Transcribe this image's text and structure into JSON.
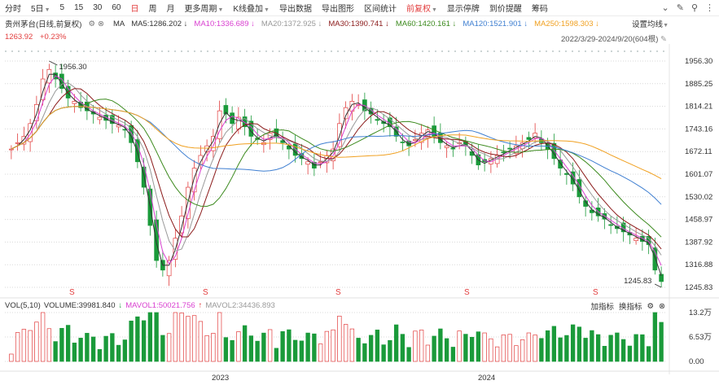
{
  "toolbar": {
    "items": [
      {
        "label": "分时",
        "active": false
      },
      {
        "label": "5日",
        "active": false,
        "dropdown": true
      },
      {
        "label": "5",
        "active": false
      },
      {
        "label": "15",
        "active": false
      },
      {
        "label": "30",
        "active": false
      },
      {
        "label": "60",
        "active": false
      },
      {
        "label": "日",
        "active": true
      },
      {
        "label": "周",
        "active": false
      },
      {
        "label": "月",
        "active": false
      },
      {
        "label": "更多周期",
        "active": false,
        "dropdown": true
      },
      {
        "label": "K线叠加",
        "active": false,
        "dropdown": true
      },
      {
        "label": "导出数据",
        "active": false
      },
      {
        "label": "导出图形",
        "active": false
      },
      {
        "label": "区间统计",
        "active": false
      },
      {
        "label": "前复权",
        "active": true,
        "dropdown": true
      },
      {
        "label": "显示停牌",
        "active": false
      },
      {
        "label": "到价提醒",
        "active": false
      },
      {
        "label": "筹码",
        "active": false
      }
    ]
  },
  "stock": {
    "title": "贵州茅台(日线,前复权)",
    "ma_label": "MA",
    "price": "1263.92",
    "change": "+0.23%"
  },
  "ma": [
    {
      "text": "MA5:1286.202",
      "arrow": "↓",
      "color": "#333333"
    },
    {
      "text": "MA10:1336.689",
      "arrow": "↓",
      "color": "#d93fd0"
    },
    {
      "text": "MA20:1372.925",
      "arrow": "↓",
      "color": "#999999"
    },
    {
      "text": "MA30:1390.741",
      "arrow": "↓",
      "color": "#8b1a1a"
    },
    {
      "text": "MA60:1420.161",
      "arrow": "↓",
      "color": "#3c8a1e"
    },
    {
      "text": "MA120:1521.901",
      "arrow": "↓",
      "color": "#3f7fd1"
    },
    {
      "text": "MA250:1598.303",
      "arrow": "↓",
      "color": "#f0a020"
    }
  ],
  "settings_label": "设置均线",
  "date_range": "2022/3/29-2024/9/20(604根)",
  "price_axis": [
    "1956.30",
    "1885.25",
    "1814.21",
    "1743.16",
    "1672.11",
    "1601.07",
    "1530.02",
    "1458.97",
    "1387.92",
    "1316.88",
    "1245.83"
  ],
  "annotations": {
    "high": "1956.30",
    "low": "1245.83"
  },
  "volume": {
    "label": "VOL(5,10)",
    "volume_text": "VOLUME:39981.840",
    "mavol1": "MAVOL1:50021.756",
    "mavol2": "MAVOL2:34436.893",
    "mavol1_arrow": "↓",
    "mavol2_arrow": "↑",
    "axis": [
      "13.2万",
      "6.53万",
      "0.00"
    ],
    "tools": {
      "add": "加指标",
      "switch": "换指标"
    }
  },
  "x_axis": [
    "2023",
    "2024"
  ],
  "colors": {
    "up": "#e23d3d",
    "down": "#1a9a3a",
    "ma5": "#333333",
    "ma10": "#d93fd0",
    "ma20": "#999999",
    "ma30": "#8b1a1a",
    "ma60": "#3c8a1e",
    "ma120": "#3f7fd1",
    "ma250": "#f0a020"
  },
  "chart_data": {
    "type": "candlestick",
    "series_note": "daily closes",
    "close": [
      1680,
      1700,
      1720,
      1760,
      1820,
      1900,
      1930,
      1900,
      1870,
      1840,
      1830,
      1810,
      1800,
      1790,
      1780,
      1770,
      1760,
      1755,
      1740,
      1700,
      1640,
      1560,
      1440,
      1330,
      1300,
      1330,
      1400,
      1470,
      1560,
      1620,
      1660,
      1690,
      1720,
      1800,
      1790,
      1760,
      1780,
      1750,
      1720,
      1710,
      1700,
      1730,
      1720,
      1700,
      1680,
      1660,
      1650,
      1640,
      1620,
      1640,
      1660,
      1680,
      1760,
      1810,
      1830,
      1820,
      1800,
      1790,
      1770,
      1760,
      1750,
      1720,
      1700,
      1690,
      1710,
      1730,
      1740,
      1720,
      1700,
      1690,
      1680,
      1700,
      1690,
      1660,
      1630,
      1640,
      1650,
      1660,
      1670,
      1680,
      1690,
      1700,
      1710,
      1730,
      1700,
      1680,
      1650,
      1620,
      1600,
      1570,
      1530,
      1500,
      1480,
      1470,
      1460,
      1440,
      1430,
      1420,
      1410,
      1400,
      1390,
      1380,
      1300,
      1264
    ]
  }
}
